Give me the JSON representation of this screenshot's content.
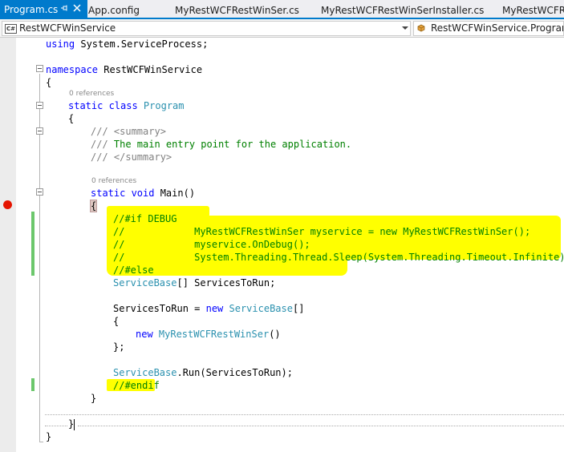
{
  "tabs": [
    {
      "label": "Program.cs",
      "active": true
    },
    {
      "label": "App.config"
    },
    {
      "label": "MyRestWCFRestWinSer.cs"
    },
    {
      "label": "MyRestWCFRestWinSerInstaller.cs"
    },
    {
      "label": "MyRestWCFRestWinSer"
    }
  ],
  "navbar": {
    "project_label": "RestWCFWinService",
    "project_icon": "C#",
    "member_label": "RestWCFWinService.Program"
  },
  "code": {
    "l1": [
      "using ",
      "System.ServiceProcess;"
    ],
    "l2": [
      "namespace ",
      "RestWCFWinService"
    ],
    "l3": "{",
    "ref1": "0 references",
    "l4": [
      "static class ",
      "Program"
    ],
    "l5": "{",
    "l6": "/// <summary>",
    "l7": [
      "/// ",
      "The main entry point for the application."
    ],
    "l8": "/// </summary>",
    "ref2": "0 references",
    "l9": [
      "static void ",
      "Main()"
    ],
    "l10": "{",
    "l11": "//#if DEBUG",
    "l12": "//            MyRestWCFRestWinSer myservice = new MyRestWCFRestWinSer();",
    "l13": "//            myservice.OnDebug();",
    "l14": "//            System.Threading.Thread.Sleep(System.Threading.Timeout.Infinite);",
    "l15": "//#else",
    "l16": [
      "ServiceBase",
      "[] ServicesToRun;"
    ],
    "l17": [
      "ServicesToRun = ",
      "new ",
      "ServiceBase",
      "[]"
    ],
    "l18": "{",
    "l19": [
      "new ",
      "MyRestWCFRestWinSer",
      "()"
    ],
    "l20": "};",
    "l21": [
      "ServiceBase",
      ".Run(ServicesToRun);"
    ],
    "l22": "//#endif",
    "l23": "}",
    "l24": "}",
    "l25": "}"
  }
}
